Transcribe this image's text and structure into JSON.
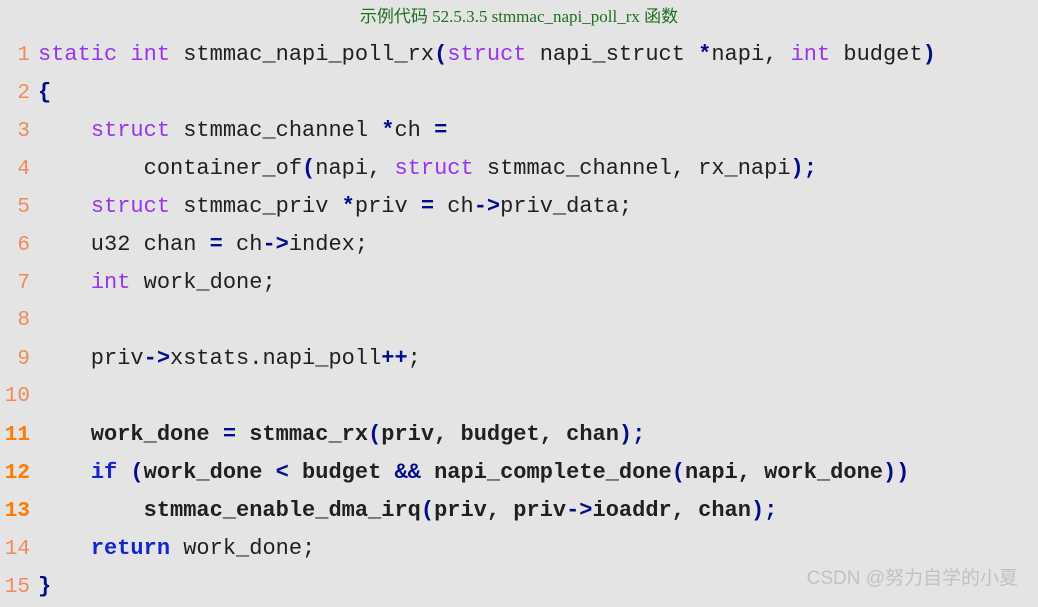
{
  "figure": {
    "caption": "示例代码 52.5.3.5 stmmac_napi_poll_rx 函数",
    "caption_color": "#1f6e1f",
    "background_color": "#e4e4e4",
    "language": "c"
  },
  "watermark": {
    "text": "CSDN @努力自学的小夏",
    "color": "#c2c2c2"
  },
  "colors": {
    "line_number": "#f08a5a",
    "line_number_highlight": "#ff7a00",
    "keyword_purple": "#9933ee",
    "keyword_blue": "#1226cc",
    "operator_navy": "#000c8c",
    "plain_text": "#202020"
  },
  "code": {
    "lines": [
      {
        "number": "1",
        "highlighted": false,
        "text": "static int stmmac_napi_poll_rx(struct napi_struct *napi, int budget)",
        "tokens": [
          {
            "t": "static",
            "c": "kw"
          },
          {
            "t": " ",
            "c": "plain"
          },
          {
            "t": "int",
            "c": "kw"
          },
          {
            "t": " stmmac_napi_poll_rx",
            "c": "plain"
          },
          {
            "t": "(",
            "c": "op"
          },
          {
            "t": "struct",
            "c": "kw"
          },
          {
            "t": " napi_struct ",
            "c": "plain"
          },
          {
            "t": "*",
            "c": "op"
          },
          {
            "t": "napi, ",
            "c": "plain"
          },
          {
            "t": "int",
            "c": "kw"
          },
          {
            "t": " budget",
            "c": "plain"
          },
          {
            "t": ")",
            "c": "op"
          }
        ]
      },
      {
        "number": "2",
        "highlighted": false,
        "text": "{",
        "tokens": [
          {
            "t": "{",
            "c": "op"
          }
        ]
      },
      {
        "number": "3",
        "highlighted": false,
        "text": "    struct stmmac_channel *ch =",
        "tokens": [
          {
            "t": "    ",
            "c": "plain"
          },
          {
            "t": "struct",
            "c": "kw"
          },
          {
            "t": " stmmac_channel ",
            "c": "plain"
          },
          {
            "t": "*",
            "c": "op"
          },
          {
            "t": "ch ",
            "c": "plain"
          },
          {
            "t": "=",
            "c": "op"
          }
        ]
      },
      {
        "number": "4",
        "highlighted": false,
        "text": "        container_of(napi, struct stmmac_channel, rx_napi);",
        "tokens": [
          {
            "t": "        container_of",
            "c": "plain"
          },
          {
            "t": "(",
            "c": "op"
          },
          {
            "t": "napi, ",
            "c": "plain"
          },
          {
            "t": "struct",
            "c": "kw"
          },
          {
            "t": " stmmac_channel, rx_napi",
            "c": "plain"
          },
          {
            "t": ");",
            "c": "op"
          }
        ]
      },
      {
        "number": "5",
        "highlighted": false,
        "text": "    struct stmmac_priv *priv = ch->priv_data;",
        "tokens": [
          {
            "t": "    ",
            "c": "plain"
          },
          {
            "t": "struct",
            "c": "kw"
          },
          {
            "t": " stmmac_priv ",
            "c": "plain"
          },
          {
            "t": "*",
            "c": "op"
          },
          {
            "t": "priv ",
            "c": "plain"
          },
          {
            "t": "=",
            "c": "op"
          },
          {
            "t": " ch",
            "c": "plain"
          },
          {
            "t": "->",
            "c": "op"
          },
          {
            "t": "priv_data;",
            "c": "plain"
          }
        ]
      },
      {
        "number": "6",
        "highlighted": false,
        "text": "    u32 chan = ch->index;",
        "tokens": [
          {
            "t": "    u32 chan ",
            "c": "plain"
          },
          {
            "t": "=",
            "c": "op"
          },
          {
            "t": " ch",
            "c": "plain"
          },
          {
            "t": "->",
            "c": "op"
          },
          {
            "t": "index;",
            "c": "plain"
          }
        ]
      },
      {
        "number": "7",
        "highlighted": false,
        "text": "    int work_done;",
        "tokens": [
          {
            "t": "    ",
            "c": "plain"
          },
          {
            "t": "int",
            "c": "kw"
          },
          {
            "t": " work_done;",
            "c": "plain"
          }
        ]
      },
      {
        "number": "8",
        "highlighted": false,
        "text": "",
        "tokens": []
      },
      {
        "number": "9",
        "highlighted": false,
        "text": "    priv->xstats.napi_poll++;",
        "tokens": [
          {
            "t": "    priv",
            "c": "plain"
          },
          {
            "t": "->",
            "c": "op"
          },
          {
            "t": "xstats.napi_poll",
            "c": "plain"
          },
          {
            "t": "++",
            "c": "op"
          },
          {
            "t": ";",
            "c": "plain"
          }
        ]
      },
      {
        "number": "10",
        "highlighted": false,
        "text": "",
        "tokens": []
      },
      {
        "number": "11",
        "highlighted": true,
        "text": "    work_done = stmmac_rx(priv, budget, chan);",
        "tokens": [
          {
            "t": "    work_done ",
            "c": "plain"
          },
          {
            "t": "=",
            "c": "op"
          },
          {
            "t": " stmmac_rx",
            "c": "plain"
          },
          {
            "t": "(",
            "c": "op"
          },
          {
            "t": "priv, budget, chan",
            "c": "plain"
          },
          {
            "t": ");",
            "c": "op"
          }
        ]
      },
      {
        "number": "12",
        "highlighted": true,
        "text": "    if (work_done < budget && napi_complete_done(napi, work_done))",
        "tokens": [
          {
            "t": "    ",
            "c": "plain"
          },
          {
            "t": "if",
            "c": "kwblue"
          },
          {
            "t": " ",
            "c": "plain"
          },
          {
            "t": "(",
            "c": "op"
          },
          {
            "t": "work_done ",
            "c": "plain"
          },
          {
            "t": "<",
            "c": "op"
          },
          {
            "t": " budget ",
            "c": "plain"
          },
          {
            "t": "&&",
            "c": "op"
          },
          {
            "t": " napi_complete_done",
            "c": "plain"
          },
          {
            "t": "(",
            "c": "op"
          },
          {
            "t": "napi, work_done",
            "c": "plain"
          },
          {
            "t": "))",
            "c": "op"
          }
        ]
      },
      {
        "number": "13",
        "highlighted": true,
        "text": "        stmmac_enable_dma_irq(priv, priv->ioaddr, chan);",
        "tokens": [
          {
            "t": "        stmmac_enable_dma_irq",
            "c": "plain"
          },
          {
            "t": "(",
            "c": "op"
          },
          {
            "t": "priv, priv",
            "c": "plain"
          },
          {
            "t": "->",
            "c": "op"
          },
          {
            "t": "ioaddr, chan",
            "c": "plain"
          },
          {
            "t": ");",
            "c": "op"
          }
        ]
      },
      {
        "number": "14",
        "highlighted": false,
        "text": "    return work_done;",
        "tokens": [
          {
            "t": "    ",
            "c": "plain"
          },
          {
            "t": "return",
            "c": "kwblue"
          },
          {
            "t": " work_done;",
            "c": "plain"
          }
        ]
      },
      {
        "number": "15",
        "highlighted": false,
        "text": "}",
        "tokens": [
          {
            "t": "}",
            "c": "op"
          }
        ]
      }
    ]
  }
}
